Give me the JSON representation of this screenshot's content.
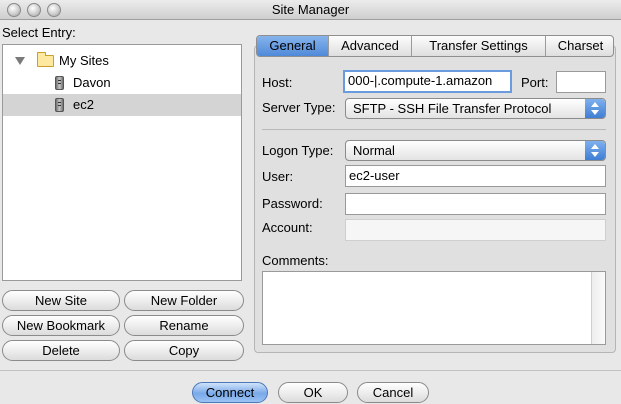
{
  "window": {
    "title": "Site Manager"
  },
  "left": {
    "select_label": "Select Entry:",
    "tree": {
      "root": {
        "label": "My Sites"
      },
      "items": [
        {
          "label": "Davon"
        },
        {
          "label": "ec2"
        }
      ]
    },
    "buttons": {
      "new_site": "New Site",
      "new_folder": "New Folder",
      "new_bookmark": "New Bookmark",
      "rename": "Rename",
      "delete": "Delete",
      "copy": "Copy"
    }
  },
  "tabs": [
    {
      "label": "General"
    },
    {
      "label": "Advanced"
    },
    {
      "label": "Transfer Settings"
    },
    {
      "label": "Charset"
    }
  ],
  "general": {
    "host_label": "Host:",
    "host_value": "000-|.compute-1.amazon",
    "port_label": "Port:",
    "port_value": "",
    "server_type_label": "Server Type:",
    "server_type_value": "SFTP - SSH File Transfer Protocol",
    "logon_type_label": "Logon Type:",
    "logon_type_value": "Normal",
    "user_label": "User:",
    "user_value": "ec2-user",
    "password_label": "Password:",
    "password_value": "",
    "account_label": "Account:",
    "account_value": "",
    "comments_label": "Comments:"
  },
  "footer": {
    "connect": "Connect",
    "ok": "OK",
    "cancel": "Cancel"
  }
}
